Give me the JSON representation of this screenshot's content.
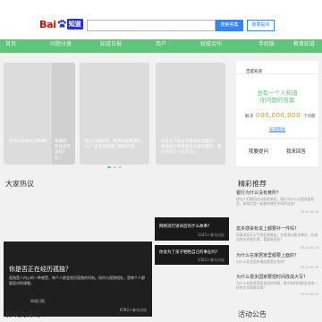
{
  "header": {
    "logo_text": "Bai",
    "logo_badge": "知道",
    "search_placeholder": "",
    "search_button": "搜索答案",
    "ask_button": "我要提问"
  },
  "nav": {
    "items": [
      "首页",
      "问题分类",
      "知道日报",
      "用户",
      "权威合作",
      "手机版",
      "教育知道"
    ]
  },
  "carousel": {
    "cards": [
      {
        "caption": "为何人会做出这种事？"
      },
      {
        "caption": "离婚后，你还会怀念吗？它..."
      },
      {
        "caption": "独立升级如何，精神你都需要什么？ 这是你需要了解的内容。"
      },
      {
        "caption": "为什么汽车必须重视这项服务？ 发动机的保养有什么要注意的，我们总结了一些方法。"
      }
    ]
  },
  "user_panel": {
    "name": "百度知道",
    "slogan_line1": "总有一个人知道",
    "slogan_line2": "你问题的答案",
    "solved_label": "解决",
    "solved_count": "000,000,000",
    "solved_unit": "个问题",
    "link": "知道帮助",
    "ask_action": "我要提问",
    "answer_action": "我来回答"
  },
  "sections": {
    "hot_title": "大家热议",
    "rec_title": "精彩推荐",
    "rank_title": "影响力排行",
    "event_title": "活动公告"
  },
  "hot": {
    "feature": {
      "title": "你是否正在经历孤独？",
      "desc": "孤独是人内心的一种感受，每个人都会经历孤独的时刻。如何与孤独相处，是每个人都要面对的课题。",
      "author": "知道日报",
      "views": "6782人参与讨论"
    },
    "side": [
      {
        "title": "网络流行语背后有什么故事？",
        "views": "1245人参与讨论"
      },
      {
        "title": "你会为了孩子牺牲自己的事业吗？",
        "views": "3502人参与讨论"
      }
    ]
  },
  "recommend": [
    {
      "title": "银行为什么没有黄所？",
      "desc": "现在人们都用自动存取款机，银行为什么还要保留柜台，和网点里一起都有哪些不同的业务？",
      "meta_left": "",
      "meta_right": "2014-06-18"
    },
    {
      "title": "患多感染有说上都要补一件吗？",
      "desc": "同事说夏天天气热容易感染，饮食清淡要多喝水，应该怎样补充维生素，需要吃药吗？",
      "meta_left": "",
      "meta_right": "2014-06-18"
    },
    {
      "title": "为什么在家居家里都要上面的？",
      "desc": "为什么家里面的墙面都是白色的？",
      "meta_left": "",
      "meta_right": "2014-06-18"
    },
    {
      "title": "为什么很多国家要把时间改成大写？",
      "desc": "为什么在很多国家里面的钟表，数字和时间都会变成一样的字母和数字呢？",
      "meta_left": "",
      "meta_right": "2014-06-18"
    }
  ],
  "colors": {
    "nav_green": "#5ec57a",
    "baidu_red": "#e10601",
    "baidu_blue": "#2932e1",
    "button_blue": "#3385ff",
    "number_orange": "#f08c1b"
  }
}
